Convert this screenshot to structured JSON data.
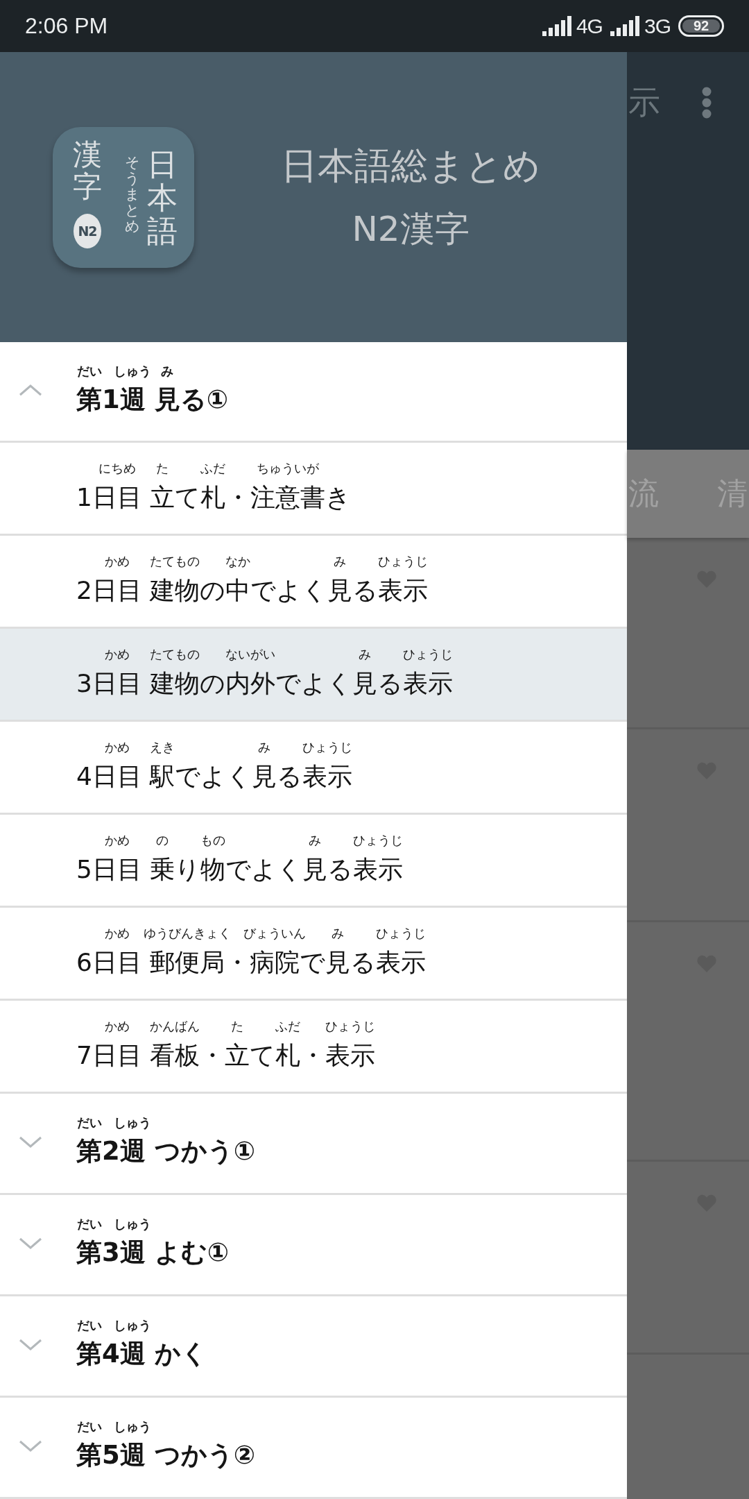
{
  "status_bar": {
    "time": "2:06 PM",
    "signals": [
      {
        "network": "4G"
      },
      {
        "network": "3G"
      }
    ],
    "battery": "92"
  },
  "app_bar": {
    "title": "示"
  },
  "tabs": [
    {
      "label": "流",
      "selected": false
    },
    {
      "label": "清",
      "selected": false
    }
  ],
  "drawer": {
    "header": {
      "title": "日本語総まとめ",
      "subtitle": "N2漢字",
      "logo": {
        "left_column": "漢字",
        "badge": "N2",
        "small_column": "そうまとめ",
        "right_column": "日本語"
      }
    },
    "sections": [
      {
        "expanded": true,
        "title": [
          {
            "text": "第",
            "ruby": "だい"
          },
          {
            "text": "1"
          },
          {
            "text": "週 ",
            "ruby": "しゅう"
          },
          {
            "text": "見",
            "ruby": "み"
          },
          {
            "text": "る①"
          }
        ],
        "days": [
          {
            "selected": false,
            "title": [
              {
                "text": "1"
              },
              {
                "text": "日目 ",
                "ruby": "にちめ"
              },
              {
                "text": "立",
                "ruby": "た"
              },
              {
                "text": "て"
              },
              {
                "text": "札",
                "ruby": "ふだ"
              },
              {
                "text": "・"
              },
              {
                "text": "注意書",
                "ruby": "ちゅういが"
              },
              {
                "text": "き"
              }
            ]
          },
          {
            "selected": false,
            "title": [
              {
                "text": "2"
              },
              {
                "text": "日目 ",
                "ruby": "かめ"
              },
              {
                "text": "建物",
                "ruby": "たてもの"
              },
              {
                "text": "の"
              },
              {
                "text": "中",
                "ruby": "なか"
              },
              {
                "text": "でよく"
              },
              {
                "text": "見",
                "ruby": "み"
              },
              {
                "text": "る"
              },
              {
                "text": "表示",
                "ruby": "ひょうじ"
              }
            ]
          },
          {
            "selected": true,
            "title": [
              {
                "text": "3"
              },
              {
                "text": "日目 ",
                "ruby": "かめ"
              },
              {
                "text": "建物",
                "ruby": "たてもの"
              },
              {
                "text": "の"
              },
              {
                "text": "内外",
                "ruby": "ないがい"
              },
              {
                "text": "でよく"
              },
              {
                "text": "見",
                "ruby": "み"
              },
              {
                "text": "る"
              },
              {
                "text": "表示",
                "ruby": "ひょうじ"
              }
            ]
          },
          {
            "selected": false,
            "title": [
              {
                "text": "4"
              },
              {
                "text": "日目 ",
                "ruby": "かめ"
              },
              {
                "text": "駅",
                "ruby": "えき"
              },
              {
                "text": "でよく"
              },
              {
                "text": "見",
                "ruby": "み"
              },
              {
                "text": "る"
              },
              {
                "text": "表示",
                "ruby": "ひょうじ"
              }
            ]
          },
          {
            "selected": false,
            "title": [
              {
                "text": "5"
              },
              {
                "text": "日目 ",
                "ruby": "かめ"
              },
              {
                "text": "乗",
                "ruby": "の"
              },
              {
                "text": "り"
              },
              {
                "text": "物",
                "ruby": "もの"
              },
              {
                "text": "でよく"
              },
              {
                "text": "見",
                "ruby": "み"
              },
              {
                "text": "る"
              },
              {
                "text": "表示",
                "ruby": "ひょうじ"
              }
            ]
          },
          {
            "selected": false,
            "title": [
              {
                "text": "6"
              },
              {
                "text": "日目 ",
                "ruby": "かめ"
              },
              {
                "text": "郵便局",
                "ruby": "ゆうびんきょく"
              },
              {
                "text": "・"
              },
              {
                "text": "病院",
                "ruby": "びょういん"
              },
              {
                "text": "で"
              },
              {
                "text": "見",
                "ruby": "み"
              },
              {
                "text": "る"
              },
              {
                "text": "表示",
                "ruby": "ひょうじ"
              }
            ]
          },
          {
            "selected": false,
            "title": [
              {
                "text": "7"
              },
              {
                "text": "日目 ",
                "ruby": "かめ"
              },
              {
                "text": "看板",
                "ruby": "かんばん"
              },
              {
                "text": "・"
              },
              {
                "text": "立",
                "ruby": "た"
              },
              {
                "text": "て"
              },
              {
                "text": "札",
                "ruby": "ふだ"
              },
              {
                "text": "・"
              },
              {
                "text": "表示",
                "ruby": "ひょうじ"
              }
            ]
          }
        ]
      },
      {
        "expanded": false,
        "title": [
          {
            "text": "第",
            "ruby": "だい"
          },
          {
            "text": "2"
          },
          {
            "text": "週",
            "ruby": "しゅう"
          },
          {
            "text": " つかう①"
          }
        ]
      },
      {
        "expanded": false,
        "title": [
          {
            "text": "第",
            "ruby": "だい"
          },
          {
            "text": "3"
          },
          {
            "text": "週",
            "ruby": "しゅう"
          },
          {
            "text": " よむ①"
          }
        ]
      },
      {
        "expanded": false,
        "title": [
          {
            "text": "第",
            "ruby": "だい"
          },
          {
            "text": "4"
          },
          {
            "text": "週",
            "ruby": "しゅう"
          },
          {
            "text": " かく"
          }
        ]
      },
      {
        "expanded": false,
        "title": [
          {
            "text": "第",
            "ruby": "だい"
          },
          {
            "text": "5"
          },
          {
            "text": "週",
            "ruby": "しゅう"
          },
          {
            "text": " つかう②"
          }
        ]
      }
    ]
  }
}
